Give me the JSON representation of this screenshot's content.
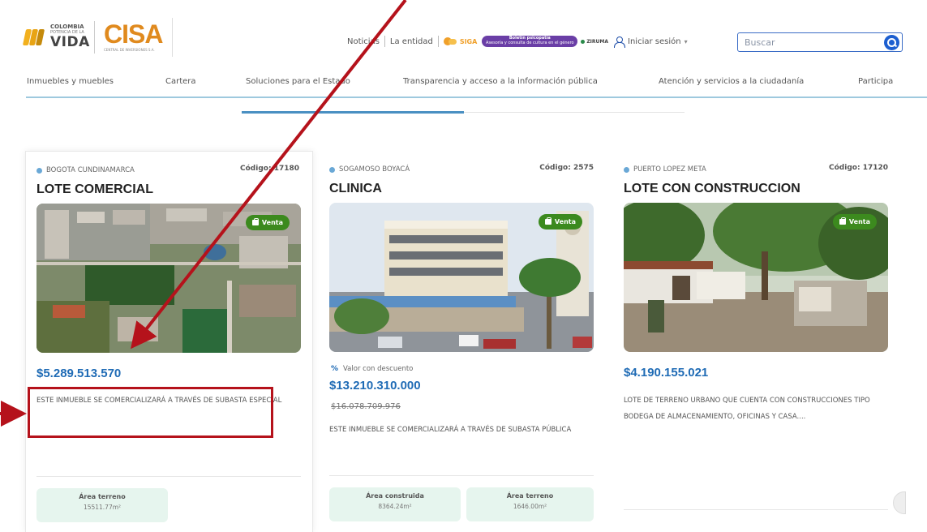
{
  "header": {
    "colombia_logo": {
      "line1": "COLOMBIA",
      "line2": "POTENCIA DE LA",
      "line3": "VIDA"
    },
    "cisa_logo": {
      "name": "CISA",
      "tagline": "CENTRAL DE INVERSIONES S.A."
    },
    "topnav": {
      "noticias": "Noticias",
      "entidad": "La entidad",
      "siga": "SIGA",
      "pill_title": "Boletín psicopatía",
      "pill_sub": "Asesoría y consulta de cultura en el género",
      "ziruma": "ZIRUMA",
      "login": "Iniciar sesión"
    },
    "search": {
      "placeholder": "Buscar"
    }
  },
  "mainnav": [
    "Inmuebles y muebles",
    "Cartera",
    "Soluciones para el Estado",
    "Transparencia y acceso a la información pública",
    "Atención y servicios a la ciudadanía",
    "Participa"
  ],
  "cards": [
    {
      "location": "BOGOTA CUNDINAMARCA",
      "code": "Código: 17180",
      "title": "LOTE COMERCIAL",
      "badge": "Venta",
      "price": "$5.289.513.570",
      "description": "ESTE INMUEBLE SE COMERCIALIZARÁ A TRAVÉS DE SUBASTA ESPECIAL",
      "areas": [
        {
          "label": "Área terreno",
          "value": "15511.77m²"
        }
      ]
    },
    {
      "location": "SOGAMOSO BOYACÁ",
      "code": "Código: 2575",
      "title": "CLINICA",
      "badge": "Venta",
      "discount_label": "Valor con descuento",
      "price": "$13.210.310.000",
      "old_price": "$16.078.709.976",
      "description": "ESTE INMUEBLE SE COMERCIALIZARÁ A TRAVÉS DE SUBASTA PÚBLICA",
      "areas": [
        {
          "label": "Área construida",
          "value": "8364.24m²"
        },
        {
          "label": "Área terreno",
          "value": "1646.00m²"
        }
      ]
    },
    {
      "location": "PUERTO LOPEZ META",
      "code": "Código: 17120",
      "title": "LOTE CON CONSTRUCCION",
      "badge": "Venta",
      "price": "$4.190.155.021",
      "description": "LOTE DE TERRENO URBANO QUE CUENTA CON CONSTRUCCIONES TIPO BODEGA DE ALMACENAMIENTO, OFICINAS Y CASA....",
      "areas": []
    }
  ],
  "colors": {
    "price": "#1f6bb5",
    "badge": "#3c8a1e",
    "annotation": "#b5121b",
    "area_bg": "#e6f5ee"
  },
  "icons": [
    "location-pin-icon",
    "shopping-bag-icon",
    "user-icon",
    "search-icon",
    "chevron-down-icon",
    "discount-icon"
  ]
}
